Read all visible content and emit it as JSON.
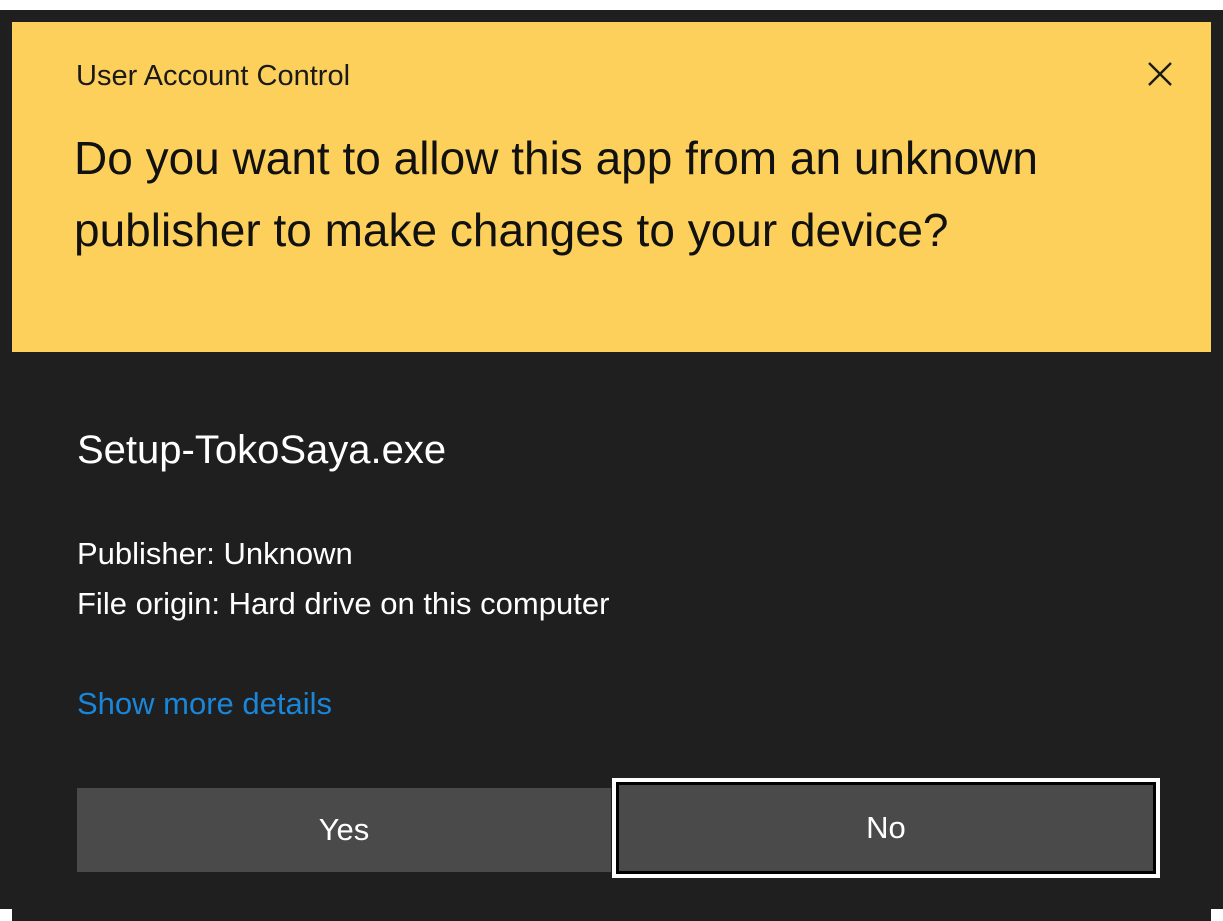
{
  "window": {
    "title": "User Account Control",
    "close_icon": "close-icon"
  },
  "prompt": {
    "question": "Do you want to allow this app from an unknown publisher to make changes to your device?",
    "app_name": "Setup-TokoSaya.exe",
    "publisher": "Publisher: Unknown",
    "file_origin": "File origin: Hard drive on this computer",
    "details_link": "Show more details"
  },
  "buttons": {
    "yes_label": "Yes",
    "no_label": "No"
  },
  "colors": {
    "header_bg": "#fdd05b",
    "body_bg": "#1f1f1f",
    "button_bg": "#4a4a4a",
    "link": "#1a86d9"
  }
}
